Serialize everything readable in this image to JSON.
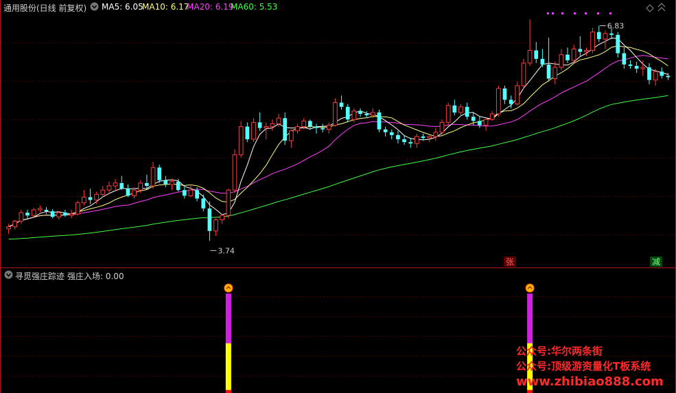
{
  "header": {
    "stock_label": "通用股份(日线 前复权)",
    "ma5_label": "MA5: 6.05",
    "ma10_label": "MA10: 6.17",
    "ma20_label": "MA20: 6.19",
    "ma60_label": "MA60: 5.53"
  },
  "indicator": {
    "title": "寻觅强庄踪迹",
    "value_label": "强庄入场: 0.00"
  },
  "annotations": {
    "high_label": "6.83",
    "low_label": "3.74",
    "zhang_badge": "张",
    "jian_badge": "减"
  },
  "watermark": {
    "line1": "公众号:华尔两条街",
    "line2": "公众号:顶级游资量化T板系统",
    "line3": "www.zhibiao888.com"
  },
  "colors": {
    "background": "#000000",
    "grid": "#4a0000",
    "up_candle": "#ff3c3c",
    "down_candle": "#54ffff",
    "ma5": "#ffffff",
    "ma10": "#ffff80",
    "ma20": "#ff40ff",
    "ma60": "#40ff40",
    "bar_yellow": "#ffff00",
    "bar_magenta": "#d020e0",
    "bar_red": "#ff0000"
  },
  "chart_data": [
    {
      "type": "candlestick",
      "title": "",
      "ylim": [
        3.5,
        7.0
      ],
      "grid": true,
      "note": "daily OHLC, oldest first",
      "candles": [
        [
          3.95,
          4.02,
          3.88,
          3.98
        ],
        [
          3.98,
          4.08,
          3.94,
          4.06
        ],
        [
          4.06,
          4.22,
          4.02,
          4.18
        ],
        [
          4.18,
          4.22,
          4.1,
          4.14
        ],
        [
          4.14,
          4.25,
          4.1,
          4.22
        ],
        [
          4.22,
          4.28,
          4.18,
          4.24
        ],
        [
          4.22,
          4.26,
          4.16,
          4.2
        ],
        [
          4.2,
          4.23,
          4.1,
          4.12
        ],
        [
          4.12,
          4.2,
          4.08,
          4.18
        ],
        [
          4.18,
          4.22,
          4.12,
          4.14
        ],
        [
          4.14,
          4.22,
          4.1,
          4.16
        ],
        [
          4.16,
          4.35,
          4.14,
          4.32
        ],
        [
          4.32,
          4.5,
          4.28,
          4.4
        ],
        [
          4.4,
          4.52,
          4.3,
          4.36
        ],
        [
          4.36,
          4.48,
          4.3,
          4.44
        ],
        [
          4.44,
          4.56,
          4.4,
          4.5
        ],
        [
          4.5,
          4.62,
          4.44,
          4.56
        ],
        [
          4.56,
          4.66,
          4.48,
          4.6
        ],
        [
          4.6,
          4.7,
          4.5,
          4.52
        ],
        [
          4.52,
          4.58,
          4.4,
          4.42
        ],
        [
          4.42,
          4.54,
          4.38,
          4.5
        ],
        [
          4.5,
          4.64,
          4.46,
          4.6
        ],
        [
          4.6,
          4.72,
          4.5,
          4.56
        ],
        [
          4.56,
          4.9,
          4.52,
          4.82
        ],
        [
          4.82,
          4.86,
          4.6,
          4.64
        ],
        [
          4.64,
          4.7,
          4.54,
          4.58
        ],
        [
          4.58,
          4.66,
          4.5,
          4.62
        ],
        [
          4.62,
          4.66,
          4.48,
          4.5
        ],
        [
          4.5,
          4.54,
          4.38,
          4.42
        ],
        [
          4.42,
          4.58,
          4.4,
          4.5
        ],
        [
          4.5,
          4.54,
          4.34,
          4.38
        ],
        [
          4.38,
          4.44,
          4.2,
          4.24
        ],
        [
          4.24,
          4.34,
          3.78,
          3.92
        ],
        [
          3.92,
          4.1,
          3.85,
          4.08
        ],
        [
          4.08,
          4.16,
          4.02,
          4.14
        ],
        [
          4.14,
          4.52,
          4.1,
          4.5
        ],
        [
          4.5,
          5.08,
          4.46,
          5.0
        ],
        [
          5.0,
          5.48,
          4.96,
          5.4
        ],
        [
          5.4,
          5.46,
          5.18,
          5.22
        ],
        [
          5.22,
          5.52,
          5.18,
          5.46
        ],
        [
          5.46,
          5.6,
          5.34,
          5.38
        ],
        [
          5.38,
          5.46,
          5.22,
          5.4
        ],
        [
          5.4,
          5.5,
          5.34,
          5.44
        ],
        [
          5.44,
          5.58,
          5.4,
          5.52
        ],
        [
          5.52,
          5.6,
          5.14,
          5.2
        ],
        [
          5.2,
          5.36,
          5.1,
          5.34
        ],
        [
          5.34,
          5.44,
          5.3,
          5.4
        ],
        [
          5.4,
          5.52,
          5.36,
          5.48
        ],
        [
          5.48,
          5.5,
          5.36,
          5.4
        ],
        [
          5.4,
          5.44,
          5.3,
          5.38
        ],
        [
          5.38,
          5.44,
          5.32,
          5.36
        ],
        [
          5.36,
          5.46,
          5.3,
          5.42
        ],
        [
          5.42,
          5.8,
          5.4,
          5.74
        ],
        [
          5.74,
          5.84,
          5.64,
          5.68
        ],
        [
          5.68,
          5.72,
          5.46,
          5.5
        ],
        [
          5.5,
          5.66,
          5.46,
          5.62
        ],
        [
          5.62,
          5.66,
          5.54,
          5.58
        ],
        [
          5.58,
          5.62,
          5.52,
          5.56
        ],
        [
          5.56,
          5.66,
          5.52,
          5.6
        ],
        [
          5.6,
          5.64,
          5.32,
          5.36
        ],
        [
          5.36,
          5.4,
          5.26,
          5.32
        ],
        [
          5.32,
          5.36,
          5.22,
          5.28
        ],
        [
          5.28,
          5.34,
          5.16,
          5.22
        ],
        [
          5.22,
          5.28,
          5.14,
          5.18
        ],
        [
          5.18,
          5.24,
          5.1,
          5.16
        ],
        [
          5.16,
          5.3,
          5.1,
          5.26
        ],
        [
          5.26,
          5.3,
          5.2,
          5.24
        ],
        [
          5.24,
          5.3,
          5.18,
          5.26
        ],
        [
          5.26,
          5.38,
          5.2,
          5.32
        ],
        [
          5.32,
          5.5,
          5.28,
          5.46
        ],
        [
          5.46,
          5.74,
          5.4,
          5.7
        ],
        [
          5.7,
          5.78,
          5.56,
          5.6
        ],
        [
          5.6,
          5.72,
          5.54,
          5.68
        ],
        [
          5.68,
          5.74,
          5.5,
          5.54
        ],
        [
          5.54,
          5.6,
          5.42,
          5.48
        ],
        [
          5.48,
          5.54,
          5.38,
          5.42
        ],
        [
          5.42,
          5.52,
          5.34,
          5.5
        ],
        [
          5.5,
          5.62,
          5.48,
          5.58
        ],
        [
          5.58,
          5.98,
          5.54,
          5.94
        ],
        [
          5.94,
          5.98,
          5.72,
          5.78
        ],
        [
          5.78,
          5.84,
          5.66,
          5.72
        ],
        [
          5.72,
          6.04,
          5.7,
          5.98
        ],
        [
          5.98,
          6.36,
          5.94,
          6.3
        ],
        [
          6.3,
          6.92,
          6.26,
          6.48
        ],
        [
          6.48,
          6.6,
          6.3,
          6.36
        ],
        [
          6.36,
          6.5,
          6.24,
          6.28
        ],
        [
          6.28,
          6.66,
          6.04,
          6.08
        ],
        [
          6.08,
          6.32,
          6.0,
          6.24
        ],
        [
          6.24,
          6.5,
          6.2,
          6.42
        ],
        [
          6.42,
          6.52,
          6.3,
          6.34
        ],
        [
          6.34,
          6.56,
          6.3,
          6.5
        ],
        [
          6.5,
          6.68,
          6.4,
          6.46
        ],
        [
          6.46,
          6.52,
          6.4,
          6.48
        ],
        [
          6.48,
          6.8,
          6.44,
          6.74
        ],
        [
          6.74,
          6.83,
          6.6,
          6.64
        ],
        [
          6.64,
          6.76,
          6.5,
          6.72
        ],
        [
          6.72,
          6.8,
          6.64,
          6.7
        ],
        [
          6.7,
          6.74,
          6.38,
          6.44
        ],
        [
          6.44,
          6.52,
          6.22,
          6.28
        ],
        [
          6.28,
          6.34,
          6.22,
          6.26
        ],
        [
          6.26,
          6.32,
          6.16,
          6.22
        ],
        [
          6.22,
          6.34,
          6.12,
          6.24
        ],
        [
          6.24,
          6.3,
          6.0,
          6.06
        ],
        [
          6.06,
          6.22,
          5.98,
          6.18
        ],
        [
          6.18,
          6.24,
          6.08,
          6.12
        ],
        [
          6.12,
          6.16,
          6.06,
          6.1
        ]
      ],
      "ma_periods": {
        "ma5": 5,
        "ma10": 10,
        "ma20": 20,
        "ma60": 60
      },
      "markers": [
        {
          "label": "6.83",
          "candle_index": 94,
          "value": 6.83
        },
        {
          "label": "3.74",
          "candle_index": 32,
          "value": 3.74
        }
      ]
    },
    {
      "type": "bar",
      "title": "寻觅强庄踪迹",
      "series_name": "强庄入场",
      "current_value": 0.0,
      "signals": [
        {
          "candle_index": 35,
          "segments": [
            {
              "color": "bar_red",
              "from": 0,
              "to": 0.03
            },
            {
              "color": "bar_yellow",
              "from": 0.03,
              "to": 0.5
            },
            {
              "color": "bar_magenta",
              "from": 0.5,
              "to": 1
            }
          ]
        },
        {
          "candle_index": 83,
          "segments": [
            {
              "color": "bar_red",
              "from": 0,
              "to": 0.03
            },
            {
              "color": "bar_yellow",
              "from": 0.03,
              "to": 0.5
            },
            {
              "color": "bar_magenta",
              "from": 0.5,
              "to": 1
            }
          ]
        }
      ]
    }
  ]
}
